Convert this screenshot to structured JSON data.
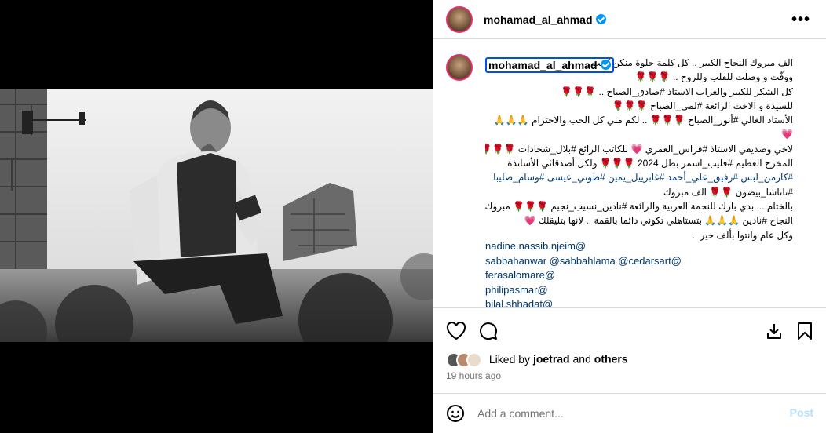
{
  "header": {
    "username": "mohamad_al_ahmad",
    "verified": true,
    "more_label": "•••"
  },
  "caption": {
    "username": "mohamad_al_ahmad",
    "lines": [
      "الف مبروك النجاح الكبير .. كل كلمة حلوة منكن كفت",
      "ووفّت و وصلت للقلب وللروح .. 🌹🌹🌹",
      "كل الشكر للكبير والعراب الاستاذ #صادق_الصباح .. 🌹🌹🌹",
      "للسيدة و الاخت الرائعة #لمى_الصباح 🌹🌹🌹",
      "الأستاذ الغالي #أنور_الصباح 🌹🌹🌹 .. لكم مني كل الحب والاحترام 🙏🙏🙏",
      "💗",
      "لاخي وصديقي الاستاذ #فراس_العمري 💗 للكاتب الرائع #بلال_شحادات 🌹🌹🌹",
      "المخرج العظيم #فليب_اسمر بطل 2024 🌹🌹🌹 ولكل أصدقائي الأساتذة",
      "#كارمن_لبس #رفيق_علي_أحمد #غابرييل_يمين #طوني_عيسى #وسام_صليبا",
      "#ناتاشا_بيضون 🌹🌹 الف مبروك",
      "بالختام ... بدي بارك للنجمة العربية والرائعة #نادين_نسيب_نجيم 🌹🌹🌹 مبروك",
      "النجاح #نادين 🙏🙏🙏 بتستاهلي تكوني دائما بالقمة .. لانها بتليقلك 💗",
      "وكل عام وانتوا بألف خير .."
    ],
    "mentions": [
      "nadine.nassib.njeim@",
      "sabbahanwar @sabbahlama @cedarsart@",
      "ferasalomare@",
      "philipasmar@",
      "bilal.shhadat@"
    ]
  },
  "actions": {
    "like_icon": "heart-icon",
    "comment_icon": "comment-icon",
    "share_icon": "share-icon",
    "save_icon": "bookmark-icon"
  },
  "likes": {
    "prefix": "Liked by",
    "user": "joetrad",
    "and": "and",
    "others": "others"
  },
  "timestamp": "19 hours ago",
  "comment": {
    "placeholder": "Add a comment...",
    "post_label": "Post"
  },
  "colors": {
    "verified": "#0095f6",
    "link": "#00376b",
    "post_disabled": "#b2dffc",
    "border": "#dbdbdb"
  }
}
